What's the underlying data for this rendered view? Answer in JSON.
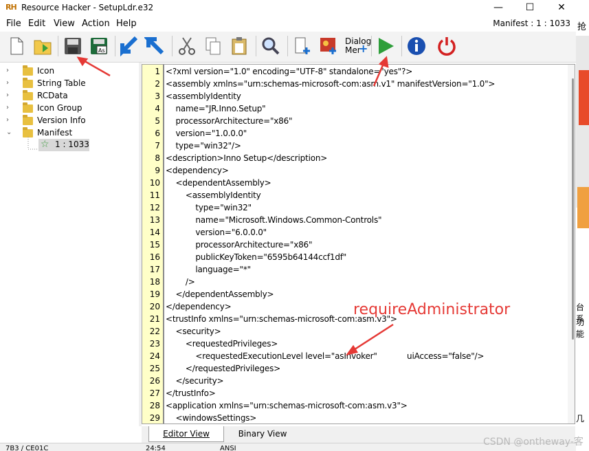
{
  "window": {
    "logo": "RH",
    "title": "Resource Hacker - SetupLdr.e32",
    "minimize": "—",
    "maximize": "☐",
    "close": "✕"
  },
  "menu": {
    "items": [
      "File",
      "Edit",
      "View",
      "Action",
      "Help"
    ],
    "manifest_label": "Manifest : 1 : 1033"
  },
  "toolbar": {
    "dialog_label_1": "Dialog",
    "dialog_label_2": "Mer"
  },
  "tree": {
    "items": [
      {
        "label": "Icon",
        "expanded": false
      },
      {
        "label": "String Table",
        "expanded": false
      },
      {
        "label": "RCData",
        "expanded": false
      },
      {
        "label": "Icon Group",
        "expanded": false
      },
      {
        "label": "Version Info",
        "expanded": false
      },
      {
        "label": "Manifest",
        "expanded": true
      }
    ],
    "child": "1 : 1033"
  },
  "editor": {
    "lines": [
      "<?xml version=\"1.0\" encoding=\"UTF-8\" standalone=\"yes\"?>",
      "<assembly xmlns=\"urn:schemas-microsoft-com:asm.v1\" manifestVersion=\"1.0\">",
      "<assemblyIdentity",
      "    name=\"JR.Inno.Setup\"",
      "    processorArchitecture=\"x86\"",
      "    version=\"1.0.0.0\"",
      "    type=\"win32\"/>",
      "<description>Inno Setup</description>",
      "<dependency>",
      "    <dependentAssembly>",
      "        <assemblyIdentity",
      "            type=\"win32\"",
      "            name=\"Microsoft.Windows.Common-Controls\"",
      "            version=\"6.0.0.0\"",
      "            processorArchitecture=\"x86\"",
      "            publicKeyToken=\"6595b64144ccf1df\"",
      "            language=\"*\"",
      "        />",
      "    </dependentAssembly>",
      "</dependency>",
      "<trustInfo xmlns=\"urn:schemas-microsoft-com:asm.v3\">",
      "    <security>",
      "        <requestedPrivileges>",
      "            <requestedExecutionLevel level=\"asInvoker\"            uiAccess=\"false\"/>",
      "        </requestedPrivileges>",
      "    </security>",
      "</trustInfo>",
      "<application xmlns=\"urn:schemas-microsoft-com:asm.v3\">",
      "    <windowsSettings>"
    ]
  },
  "tabs": {
    "editor_view": "Editor View",
    "binary_view": "Binary View"
  },
  "status": {
    "left": "7B3 / CE01C",
    "pos": "24:54",
    "enc": "ANSI"
  },
  "annotation": {
    "text": "requireAdministrator"
  },
  "watermark": "CSDN @ontheway-客",
  "side_strip": {
    "text_1": "抢",
    "text_2": "台系",
    "text_3": "功能",
    "text_4": "几"
  },
  "colors": {
    "gutter": "#ffffc8",
    "annotation": "#e53935",
    "run_green": "#2e9e3a",
    "power_red": "#d32020",
    "info_blue": "#1a4fb0"
  }
}
